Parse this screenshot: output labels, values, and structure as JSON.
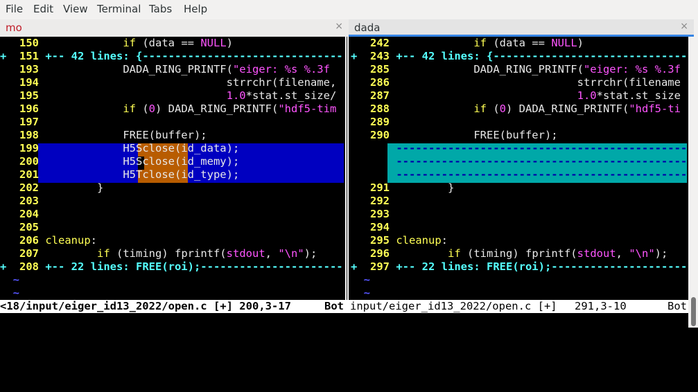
{
  "menu": [
    "File",
    "Edit",
    "View",
    "Terminal",
    "Tabs",
    "Help"
  ],
  "tabs": [
    {
      "label": "mo",
      "close": "×"
    },
    {
      "label": "dada",
      "close": "×"
    }
  ],
  "left": {
    "lines": [
      {
        "n": "150",
        "p": "",
        "t": "            if (data == NULL)"
      },
      {
        "n": "151",
        "p": "+ ",
        "t": "+-- 42 lines: {------------------------------------"
      },
      {
        "n": "193",
        "p": "",
        "t": "            DADA_RING_PRINTF(\"eiger: %s %.3f"
      },
      {
        "n": "194",
        "p": "",
        "t": "                            strrchr(filename,"
      },
      {
        "n": "195",
        "p": "",
        "t": "                            1.0*stat.st_size/"
      },
      {
        "n": "196",
        "p": "",
        "t": "            if (0) DADA_RING_PRINTF(\"hdf5-tim"
      },
      {
        "n": "197",
        "p": "",
        "t": ""
      },
      {
        "n": "198",
        "p": "",
        "t": "            FREE(buffer);"
      },
      {
        "n": "199",
        "p": "",
        "t": "            H5Sclose(id_data);"
      },
      {
        "n": "200",
        "p": "",
        "t": "            H5Sclose(id_memy);"
      },
      {
        "n": "201",
        "p": "",
        "t": "            H5Tclose(id_type);"
      },
      {
        "n": "202",
        "p": "",
        "t": "        }"
      },
      {
        "n": "203",
        "p": "",
        "t": ""
      },
      {
        "n": "204",
        "p": "",
        "t": ""
      },
      {
        "n": "205",
        "p": "",
        "t": ""
      },
      {
        "n": "206",
        "p": "",
        "t": "cleanup:"
      },
      {
        "n": "207",
        "p": "",
        "t": "        if (timing) fprintf(stdout, \"\\n\");"
      },
      {
        "n": "208",
        "p": "+ ",
        "t": "+-- 22 lines: FREE(roi);---------------------------"
      }
    ],
    "status_file": "<18/input/eiger_id13_2022/open.c [+] 200,3-17",
    "status_pos": "Bot"
  },
  "right": {
    "lines": [
      {
        "n": "242",
        "t": "            if (data == NULL)"
      },
      {
        "n": "243",
        "p": "+ ",
        "t": "+-- 42 lines: {------------------------------------"
      },
      {
        "n": "285",
        "t": "            DADA_RING_PRINTF(\"eiger: %s %.3f"
      },
      {
        "n": "286",
        "t": "                            strrchr(filename"
      },
      {
        "n": "287",
        "t": "                            1.0*stat.st_size"
      },
      {
        "n": "288",
        "t": "            if (0) DADA_RING_PRINTF(\"hdf5-ti"
      },
      {
        "n": "289",
        "t": ""
      },
      {
        "n": "290",
        "t": "            FREE(buffer);"
      },
      {
        "n": "",
        "t": "-------------------------------------------------------"
      },
      {
        "n": "",
        "t": "-------------------------------------------------------"
      },
      {
        "n": "",
        "t": "-------------------------------------------------------"
      },
      {
        "n": "291",
        "t": "        }"
      },
      {
        "n": "292",
        "t": ""
      },
      {
        "n": "293",
        "t": ""
      },
      {
        "n": "294",
        "t": ""
      },
      {
        "n": "295",
        "t": "cleanup:"
      },
      {
        "n": "296",
        "t": "        if (timing) fprintf(stdout, \"\\n\");"
      },
      {
        "n": "297",
        "p": "+ ",
        "t": "+-- 22 lines: FREE(roi);---------------------------"
      }
    ],
    "status_file": "input/eiger_id13_2022/open.c [+]",
    "status_lc": "291,3-10",
    "status_pos": "Bot"
  },
  "tilde": "~",
  "colors": {
    "diff_change": "#0000c0",
    "diff_text": "#b85c00",
    "diff_delete": "#00a8a8",
    "line_number": "#ffff55",
    "fold": "#55ffff"
  }
}
